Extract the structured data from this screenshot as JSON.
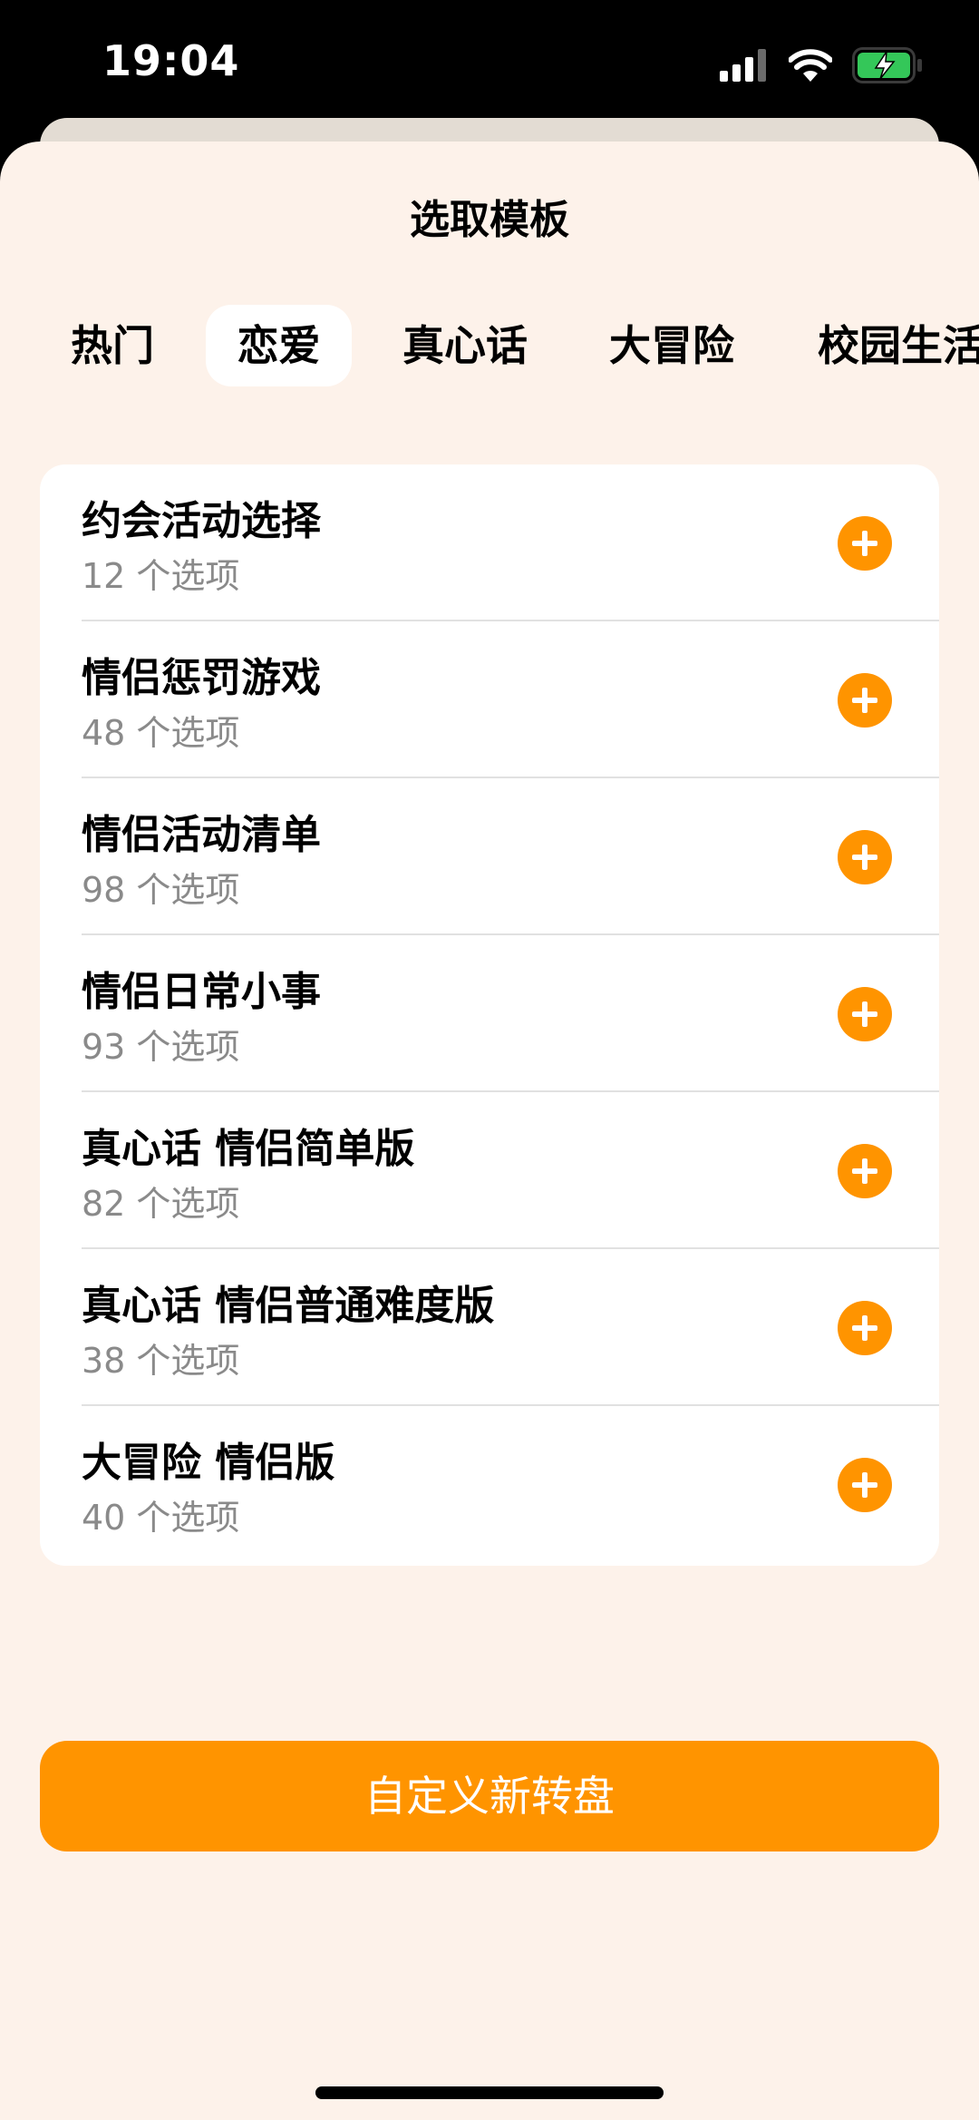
{
  "status_bar": {
    "time": "19:04"
  },
  "sheet": {
    "title": "选取模板"
  },
  "tabs": [
    {
      "label": "热门"
    },
    {
      "label": "恋爱"
    },
    {
      "label": "真心话"
    },
    {
      "label": "大冒险"
    },
    {
      "label": "校园生活"
    }
  ],
  "active_tab": "恋爱",
  "templates": [
    {
      "title": "约会活动选择",
      "count": "12 个选项"
    },
    {
      "title": "情侣惩罚游戏",
      "count": "48 个选项"
    },
    {
      "title": "情侣活动清单",
      "count": "98 个选项"
    },
    {
      "title": "情侣日常小事",
      "count": "93 个选项"
    },
    {
      "title": "真心话 情侣简单版",
      "count": "82 个选项"
    },
    {
      "title": "真心话 情侣普通难度版",
      "count": "38 个选项"
    },
    {
      "title": "大冒险 情侣版",
      "count": "40 个选项"
    }
  ],
  "footer": {
    "custom_button_label": "自定义新转盘"
  },
  "colors": {
    "accent": "#ff9400",
    "sheet_bg": "#fdf2ea",
    "battery": "#34c759"
  }
}
